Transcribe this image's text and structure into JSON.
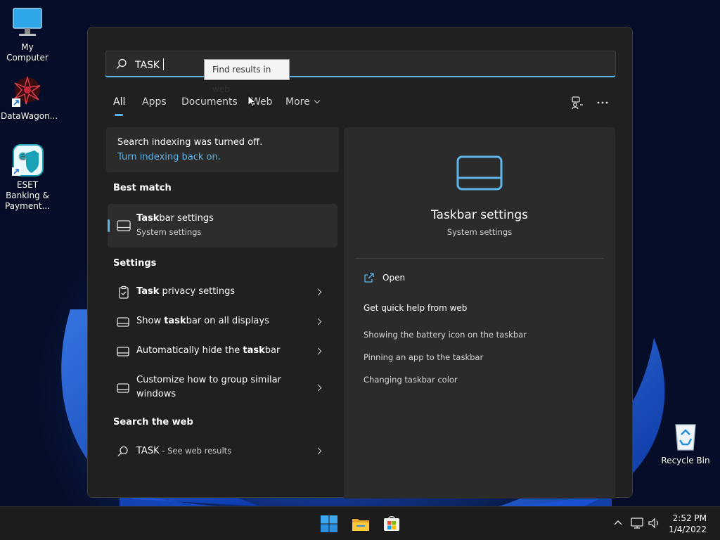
{
  "desktop": {
    "icons": [
      {
        "label": "My Computer",
        "icon": "monitor-icon"
      },
      {
        "label": "DataWagon...",
        "icon": "datawagon-icon"
      },
      {
        "label": "ESET Banking & Payment...",
        "icon": "eset-icon"
      },
      {
        "label": "Recycle Bin",
        "icon": "recycle-bin-icon"
      }
    ]
  },
  "search": {
    "query": "TASK",
    "tooltip": "Find results in web"
  },
  "tabs": [
    {
      "label": "All",
      "active": true
    },
    {
      "label": "Apps"
    },
    {
      "label": "Documents"
    },
    {
      "label": "Web"
    },
    {
      "label": "More"
    }
  ],
  "indexing": {
    "message": "Search indexing was turned off.",
    "link": "Turn indexing back on."
  },
  "best_match": {
    "heading": "Best match",
    "title_bold": "Task",
    "title_rest": "bar settings",
    "subtitle": "System settings"
  },
  "settings": {
    "heading": "Settings",
    "items": [
      {
        "bold": "Task",
        "rest": " privacy settings",
        "pre": "",
        "icon": "clipboard-icon"
      },
      {
        "pre": "Show ",
        "bold": "task",
        "rest": "bar on all displays",
        "icon": "taskbar-icon"
      },
      {
        "pre": "Automatically hide the ",
        "bold": "task",
        "rest": "bar",
        "icon": "taskbar-icon"
      },
      {
        "pre": "Customize how to group similar windows",
        "bold": "",
        "rest": "",
        "icon": "taskbar-icon"
      }
    ]
  },
  "web": {
    "heading": "Search the web",
    "query": "TASK",
    "suffix": " - See web results"
  },
  "detail": {
    "title": "Taskbar settings",
    "subtitle": "System settings",
    "open_label": "Open",
    "quick_help": "Get quick help from web",
    "help_links": [
      "Showing the battery icon on the taskbar",
      "Pinning an app to the taskbar",
      "Changing taskbar color"
    ]
  },
  "clock": {
    "time": "2:52 PM",
    "date": "1/4/2022"
  },
  "colors": {
    "accent": "#5cb4ea",
    "panel": "#202020",
    "card": "#2b2b2b",
    "taskbar": "#1c1c1c"
  }
}
